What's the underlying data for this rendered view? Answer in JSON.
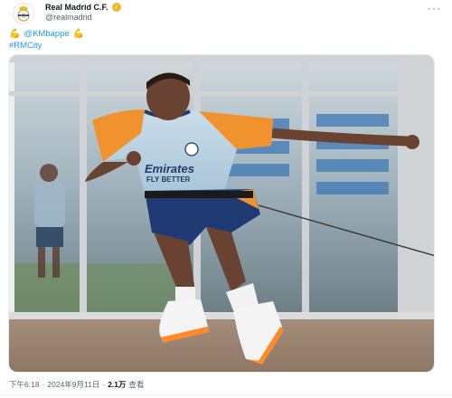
{
  "account": {
    "display_name": "Real Madrid C.F.",
    "handle": "@realmadrid",
    "avatar_icon": "real-madrid-crest-icon",
    "verified_icon": "verified-gold-badge-icon",
    "verified_color": "#e8b92e"
  },
  "more_icon": "more-dots-icon",
  "tweet": {
    "emoji_left": "💪",
    "mention": "@KMbappe",
    "emoji_right": "💪",
    "hashtag": "#RMCity",
    "link_color": "#1d9bf0"
  },
  "media": {
    "description_icon": "training-photo-image",
    "shirt_text_line1": "Emirates",
    "shirt_text_line2": "FLY BETTER"
  },
  "meta": {
    "time": "下午6:18",
    "sep1": "·",
    "date": "2024年9月11日",
    "sep2": "·",
    "views_count": "2.1万",
    "views_label": "查看"
  }
}
